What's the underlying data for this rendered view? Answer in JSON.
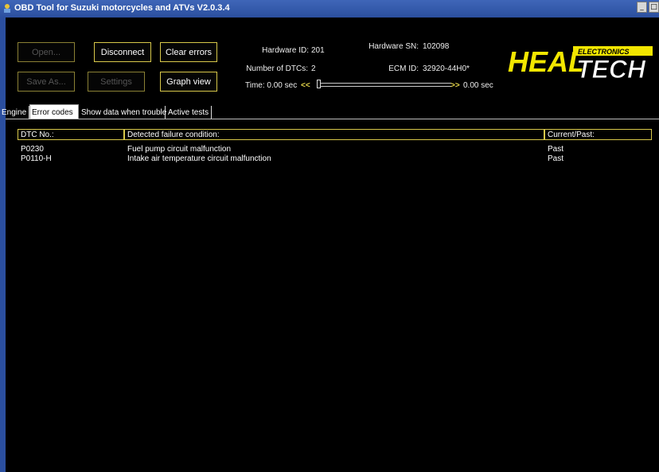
{
  "window": {
    "title": "OBD Tool for Suzuki motorcycles and ATVs V2.0.3.4",
    "controls": [
      "_",
      "□"
    ]
  },
  "toolbar": {
    "open_label": "Open...",
    "disconnect_label": "Disconnect",
    "clear_errors_label": "Clear errors",
    "save_as_label": "Save As...",
    "settings_label": "Settings",
    "graph_view_label": "Graph view"
  },
  "info": {
    "hardware_id_label": "Hardware ID:",
    "hardware_id_value": "201",
    "hardware_sn_label": "Hardware SN:",
    "hardware_sn_value": "102098",
    "dtc_count_label": "Number of DTCs:",
    "dtc_count_value": "2",
    "ecm_id_label": "ECM ID:",
    "ecm_id_value": "32920-44H0*",
    "time_label": "Time: 0.00 sec",
    "rewind_glyph": "<<",
    "forward_glyph": ">>",
    "time_end_label": "0.00 sec"
  },
  "logo": {
    "brand_left": "HEAL",
    "brand_right": "TECH",
    "tagline": "ELECTRONICS"
  },
  "tabs": [
    {
      "label": "Engine",
      "active": false
    },
    {
      "label": "Error codes",
      "active": true
    },
    {
      "label": "Show data when trouble",
      "active": false
    },
    {
      "label": "Active tests",
      "active": false
    }
  ],
  "table": {
    "headers": [
      "DTC No.:",
      "Detected failure condition:",
      "Current/Past:"
    ],
    "rows": [
      [
        "P0230",
        "Fuel pump circuit malfunction",
        "Past"
      ],
      [
        "P0110-H",
        "Intake air temperature circuit malfunction",
        "Past"
      ]
    ]
  },
  "colors": {
    "title_bar": "#2b4f9f",
    "background": "#000000",
    "button_border": "#d8c84a",
    "logo_yellow": "#f2e600"
  },
  "icons": {
    "app": "app-icon",
    "minimize": "minimize-icon",
    "maximize": "maximize-icon"
  }
}
